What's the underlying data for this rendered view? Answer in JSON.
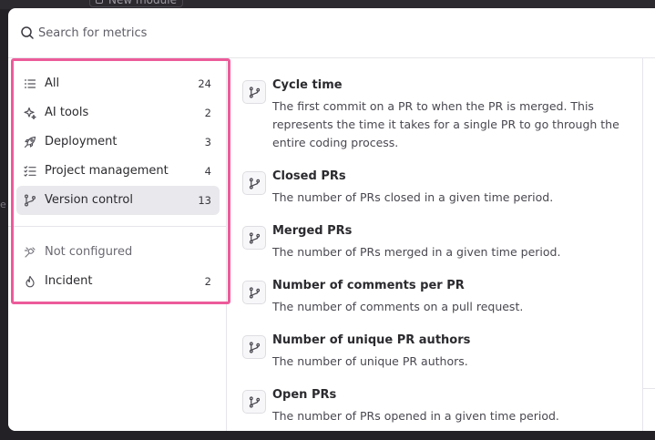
{
  "background": {
    "top_button_label": "New module",
    "left_glyph": "e"
  },
  "search": {
    "placeholder": "Search for metrics"
  },
  "categories": [
    {
      "label": "All",
      "count": "24",
      "icon": "list-icon"
    },
    {
      "label": "AI tools",
      "count": "2",
      "icon": "sparkles-icon"
    },
    {
      "label": "Deployment",
      "count": "3",
      "icon": "rocket-icon"
    },
    {
      "label": "Project management",
      "count": "4",
      "icon": "checklist-icon"
    },
    {
      "label": "Version control",
      "count": "13",
      "icon": "git-branch-icon",
      "active": true
    }
  ],
  "other_categories": [
    {
      "label": "Not configured",
      "count": "",
      "icon": "plug-disconnected-icon"
    },
    {
      "label": "Incident",
      "count": "2",
      "icon": "flame-icon"
    }
  ],
  "metrics": [
    {
      "title": "Cycle time",
      "description": "The first commit on a PR to when the PR is merged. This represents the time it takes for a single PR to go through the entire coding process."
    },
    {
      "title": "Closed PRs",
      "description": "The number of PRs closed in a given time period."
    },
    {
      "title": "Merged PRs",
      "description": "The number of PRs merged in a given time period."
    },
    {
      "title": "Number of comments per PR",
      "description": "The number of comments on a pull request."
    },
    {
      "title": "Number of unique PR authors",
      "description": "The number of unique PR authors."
    },
    {
      "title": "Open PRs",
      "description": "The number of PRs opened in a given time period."
    }
  ],
  "colors": {
    "highlight": "#ec5b9a",
    "active_bg": "#e9e8ec"
  }
}
